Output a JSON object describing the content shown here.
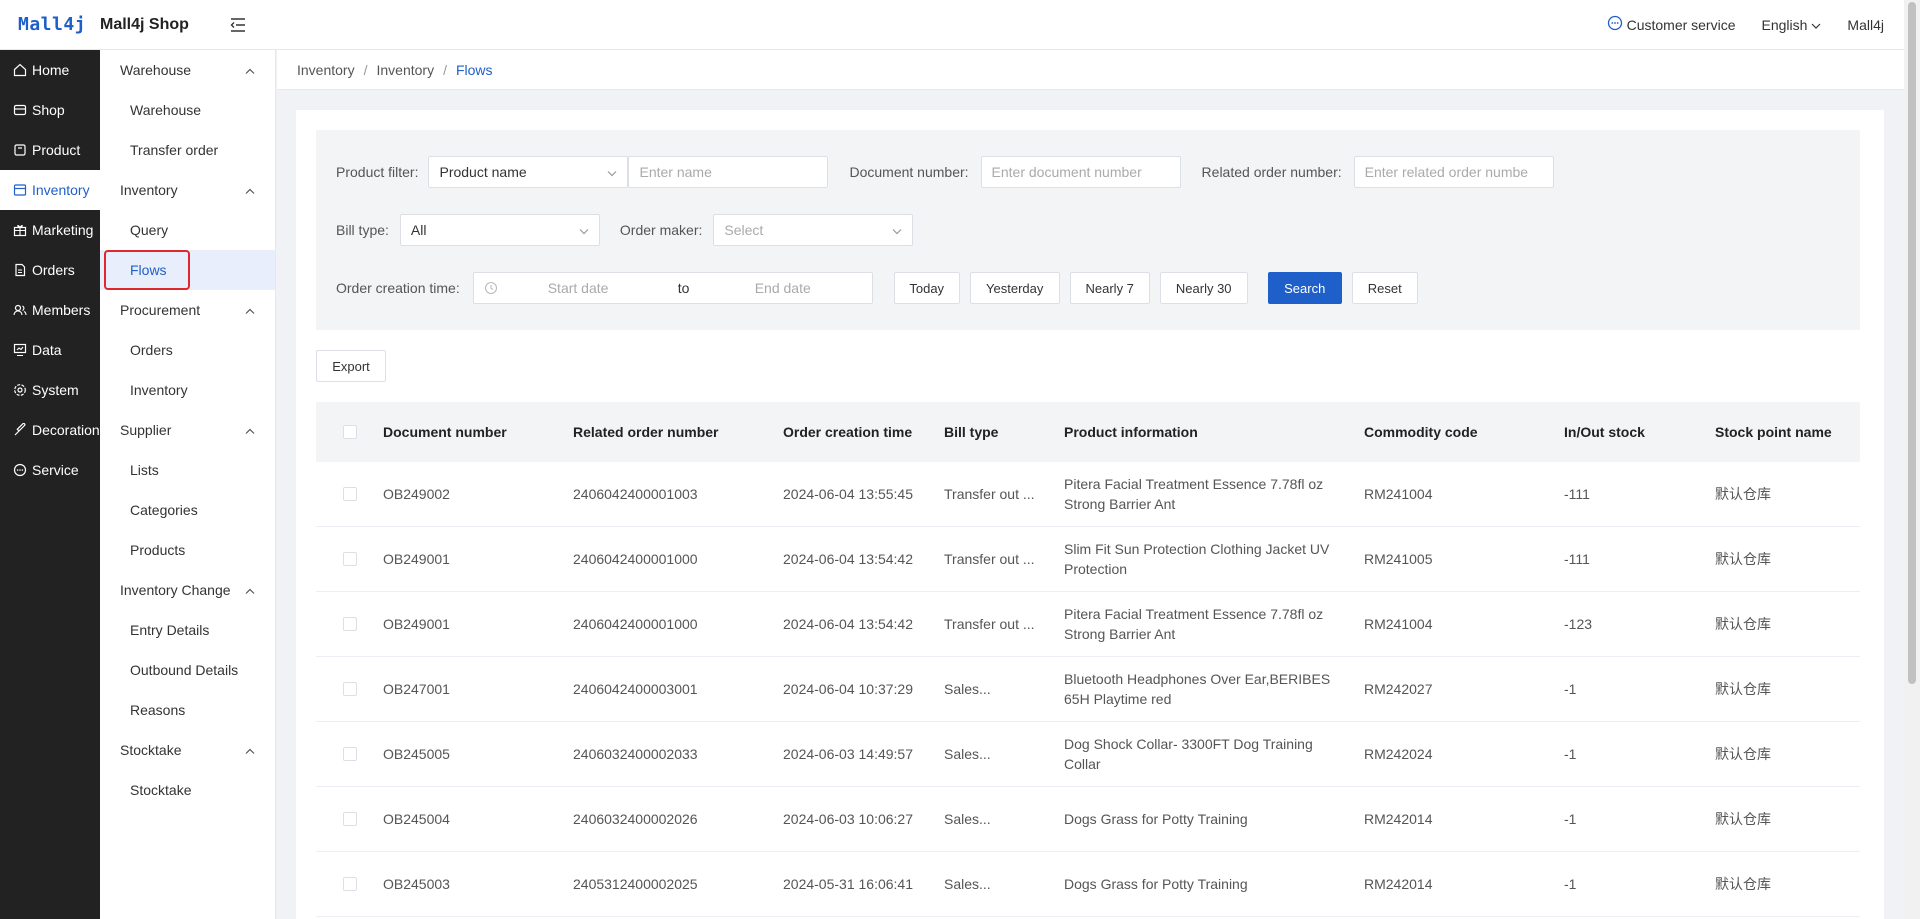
{
  "header": {
    "logo": "Mall4j",
    "shop_name": "Mall4j Shop",
    "customer_service": "Customer service",
    "language": "English",
    "user": "Mall4j"
  },
  "side_main": [
    {
      "label": "Home",
      "icon": "home-icon"
    },
    {
      "label": "Shop",
      "icon": "shop-icon"
    },
    {
      "label": "Product",
      "icon": "product-icon"
    },
    {
      "label": "Inventory",
      "icon": "inventory-icon",
      "active": true
    },
    {
      "label": "Marketing",
      "icon": "gift-icon"
    },
    {
      "label": "Orders",
      "icon": "orders-icon"
    },
    {
      "label": "Members",
      "icon": "members-icon"
    },
    {
      "label": "Data",
      "icon": "data-icon"
    },
    {
      "label": "System",
      "icon": "gear-icon"
    },
    {
      "label": "Decoration",
      "icon": "decoration-icon"
    },
    {
      "label": "Service",
      "icon": "chat-icon"
    }
  ],
  "side_sub": {
    "warehouse": "Warehouse",
    "warehouse_item": "Warehouse",
    "transfer_order": "Transfer order",
    "inventory": "Inventory",
    "query": "Query",
    "flows": "Flows",
    "procurement": "Procurement",
    "proc_orders": "Orders",
    "proc_inventory": "Inventory",
    "supplier": "Supplier",
    "lists": "Lists",
    "categories": "Categories",
    "products": "Products",
    "inventory_change": "Inventory Change",
    "entry_details": "Entry Details",
    "outbound_details": "Outbound Details",
    "reasons": "Reasons",
    "stocktake": "Stocktake",
    "stocktake_item": "Stocktake"
  },
  "breadcrumb": [
    "Inventory",
    "Inventory",
    "Flows"
  ],
  "filters": {
    "product_filter_label": "Product filter:",
    "product_filter_value": "Product name",
    "product_name_placeholder": "Enter name",
    "doc_number_label": "Document number:",
    "doc_number_placeholder": "Enter document number",
    "related_label": "Related order number:",
    "related_placeholder": "Enter related order numbe",
    "bill_type_label": "Bill type:",
    "bill_type_value": "All",
    "order_maker_label": "Order maker:",
    "order_maker_placeholder": "Select",
    "creation_time_label": "Order creation time:",
    "start_placeholder": "Start date",
    "to": "to",
    "end_placeholder": "End date",
    "today": "Today",
    "yesterday": "Yesterday",
    "nearly7": "Nearly 7",
    "nearly30": "Nearly 30",
    "search": "Search",
    "reset": "Reset"
  },
  "export_label": "Export",
  "table": {
    "headers": [
      "Document number",
      "Related order number",
      "Order creation time",
      "Bill type",
      "Product information",
      "Commodity code",
      "In/Out stock",
      "Stock point name"
    ],
    "rows": [
      [
        "OB249002",
        "2406042400001003",
        "2024-06-04 13:55:45",
        "Transfer out ...",
        "Pitera Facial Treatment Essence 7.78fl oz Strong Barrier Ant",
        "RM241004",
        "-111",
        "默认仓库"
      ],
      [
        "OB249001",
        "2406042400001000",
        "2024-06-04 13:54:42",
        "Transfer out ...",
        "Slim Fit Sun Protection Clothing Jacket UV Protection",
        "RM241005",
        "-111",
        "默认仓库"
      ],
      [
        "OB249001",
        "2406042400001000",
        "2024-06-04 13:54:42",
        "Transfer out ...",
        "Pitera Facial Treatment Essence 7.78fl oz Strong Barrier Ant",
        "RM241004",
        "-123",
        "默认仓库"
      ],
      [
        "OB247001",
        "2406042400003001",
        "2024-06-04 10:37:29",
        "Sales...",
        "Bluetooth Headphones Over Ear,BERIBES 65H Playtime red",
        "RM242027",
        "-1",
        "默认仓库"
      ],
      [
        "OB245005",
        "2406032400002033",
        "2024-06-03 14:49:57",
        "Sales...",
        "Dog Shock Collar- 3300FT Dog Training Collar",
        "RM242024",
        "-1",
        "默认仓库"
      ],
      [
        "OB245004",
        "2406032400002026",
        "2024-06-03 10:06:27",
        "Sales...",
        "Dogs Grass for Potty Training",
        "RM242014",
        "-1",
        "默认仓库"
      ],
      [
        "OB245003",
        "2405312400002025",
        "2024-05-31 16:06:41",
        "Sales...",
        "Dogs Grass for Potty Training",
        "RM242014",
        "-1",
        "默认仓库"
      ]
    ]
  },
  "colors": {
    "accent": "#1f5fc9",
    "sidebar": "#222222",
    "highlight": "#e0272c"
  }
}
